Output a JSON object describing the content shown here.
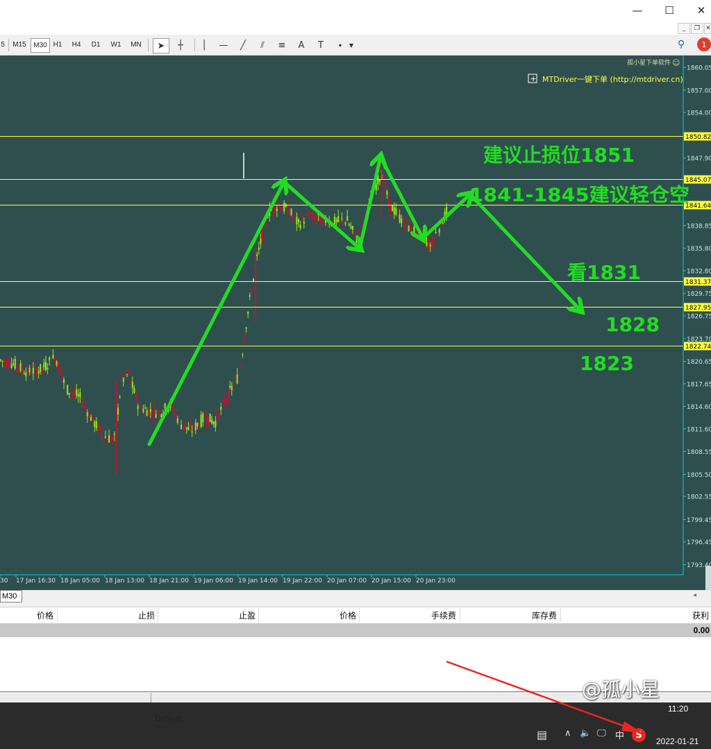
{
  "window": {
    "minimize_glyph": "—",
    "maximize_glyph": "☐",
    "close_glyph": "✕"
  },
  "mdi": {
    "minimize": "_",
    "restore": "❐",
    "close": "✕"
  },
  "toolbar": {
    "timeframes": [
      "5",
      "M15",
      "M30",
      "H1",
      "H4",
      "D1",
      "W1",
      "MN"
    ],
    "active_timeframe": "M30",
    "tools": [
      {
        "name": "cursor-icon",
        "glyph": "➤"
      },
      {
        "name": "crosshair-icon",
        "glyph": "┼"
      },
      {
        "name": "vertical-line-icon",
        "glyph": "│"
      },
      {
        "name": "horizontal-line-icon",
        "glyph": "—"
      },
      {
        "name": "trendline-icon",
        "glyph": "╱"
      },
      {
        "name": "fibonacci-fan-icon",
        "glyph": "⫽"
      },
      {
        "name": "fibonacci-retracement-icon",
        "glyph": "≡"
      },
      {
        "name": "text-icon",
        "glyph": "A"
      },
      {
        "name": "text-label-icon",
        "glyph": "T"
      },
      {
        "name": "shapes-menu-icon",
        "glyph": "⬩"
      }
    ],
    "search_icon": "search-icon",
    "notification_count": "1"
  },
  "chart": {
    "background": "#2f4f4f",
    "axis_color": "#00d0d0",
    "bull_color": "#9ae61e",
    "bear_color": "#c8102e",
    "level_color": "#ffff40",
    "annotation_color": "#22dd22",
    "vendor_label": "孤小星下单软件",
    "ea_label": "MTDriver一键下单 (http://mtdriver.cn)",
    "price_ticks": [
      "1860.05",
      "1857.00",
      "1854.00",
      "1847.90",
      "1838.85",
      "1835.80",
      "1832.80",
      "1829.75",
      "1826.75",
      "1823.70",
      "1820.65",
      "1817.65",
      "1814.60",
      "1811.60",
      "1808.55",
      "1805.50",
      "1802.55",
      "1799.45",
      "1796.45",
      "1793.40"
    ],
    "levels": [
      {
        "label": "1850.82"
      },
      {
        "label": "1845.07"
      },
      {
        "label": "1841.64"
      },
      {
        "label": "1831.37"
      },
      {
        "label": "1827.95"
      },
      {
        "label": "1822.74"
      }
    ],
    "time_ticks": [
      "30",
      "17 Jan 16:30",
      "18 Jan 05:00",
      "18 Jan 13:00",
      "18 Jan 21:00",
      "19 Jan 06:00",
      "19 Jan 14:00",
      "19 Jan 22:00",
      "20 Jan 07:00",
      "20 Jan 15:00",
      "20 Jan 23:00"
    ],
    "annotations": {
      "stop_loss": "建议止损位1851",
      "short_zone": "1841-1845建议轻仓空",
      "target1": "看1831",
      "target2": "1828",
      "target3": "1823"
    }
  },
  "tabs": {
    "active": "M30"
  },
  "terminal": {
    "columns": [
      "价格",
      "止损",
      "止盈",
      "价格",
      "手续费",
      "库存费",
      "获利"
    ],
    "total_profit": "0.00"
  },
  "statusbar": {
    "profile": "Default"
  },
  "taskbar": {
    "ime": "中",
    "time": "11:20",
    "date": "2022-01-21",
    "sogou": "S"
  },
  "watermark": "@孤小星"
}
